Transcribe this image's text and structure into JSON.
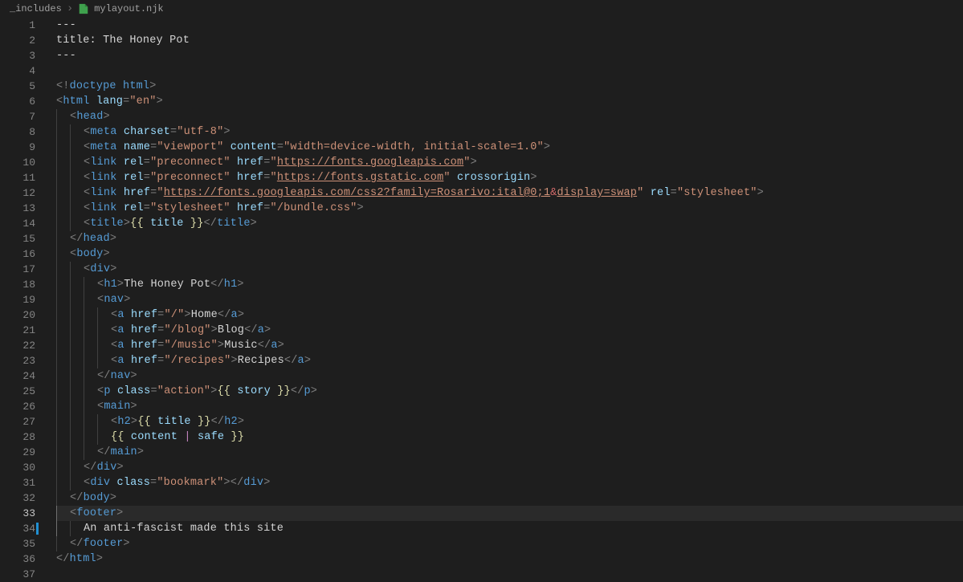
{
  "breadcrumb": {
    "folder": "_includes",
    "file": "mylayout.njk"
  },
  "gutter": {
    "currentLine": 33,
    "modifiedLine": 34,
    "lineCount": 37
  },
  "code": {
    "l1": "---",
    "l2_key": "title: ",
    "l2_val": "The Honey Pot",
    "l3": "---",
    "l5_doctype": "doctype html",
    "l6_tag": "html",
    "l6_attr": "lang",
    "l6_val": "\"en\"",
    "l7_tag": "head",
    "l8_tag": "meta",
    "l8_attr": "charset",
    "l8_val": "\"utf-8\"",
    "l9_tag": "meta",
    "l9_a1": "name",
    "l9_v1": "\"viewport\"",
    "l9_a2": "content",
    "l9_v2": "\"width=device-width, initial-scale=1.0\"",
    "l10_tag": "link",
    "l10_a1": "rel",
    "l10_v1": "\"preconnect\"",
    "l10_a2": "href",
    "l10_q": "\"",
    "l10_url": "https://fonts.googleapis.com",
    "l11_tag": "link",
    "l11_a1": "rel",
    "l11_v1": "\"preconnect\"",
    "l11_a2": "href",
    "l11_q": "\"",
    "l11_url": "https://fonts.gstatic.com",
    "l11_a3": "crossorigin",
    "l12_tag": "link",
    "l12_a1": "href",
    "l12_q": "\"",
    "l12_url1": "https://fonts.googleapis.com/css2?family=Rosarivo:ital@0;1",
    "l12_amp": "&",
    "l12_url2": "display=swap",
    "l12_a2": "rel",
    "l12_v2": "\"stylesheet\"",
    "l13_tag": "link",
    "l13_a1": "rel",
    "l13_v1": "\"stylesheet\"",
    "l13_a2": "href",
    "l13_v2": "\"/bundle.css\"",
    "l14_tag": "title",
    "l14_open": "{{",
    "l14_var": "title",
    "l14_close": "}}",
    "l15_tag": "head",
    "l16_tag": "body",
    "l17_tag": "div",
    "l18_tag": "h1",
    "l18_text": "The Honey Pot",
    "l19_tag": "nav",
    "l20_tag": "a",
    "l20_attr": "href",
    "l20_val": "\"/\"",
    "l20_text": "Home",
    "l21_tag": "a",
    "l21_attr": "href",
    "l21_val": "\"/blog\"",
    "l21_text": "Blog",
    "l22_tag": "a",
    "l22_attr": "href",
    "l22_val": "\"/music\"",
    "l22_text": "Music",
    "l23_tag": "a",
    "l23_attr": "href",
    "l23_val": "\"/recipes\"",
    "l23_text": "Recipes",
    "l24_tag": "nav",
    "l25_tag": "p",
    "l25_attr": "class",
    "l25_val": "\"action\"",
    "l25_open": "{{",
    "l25_var": "story",
    "l25_close": "}}",
    "l26_tag": "main",
    "l27_tag": "h2",
    "l27_open": "{{",
    "l27_var": "title",
    "l27_close": "}}",
    "l28_open": "{{",
    "l28_var": "content",
    "l28_pipe": "|",
    "l28_filter": "safe",
    "l28_close": "}}",
    "l29_tag": "main",
    "l30_tag": "div",
    "l31_tag": "div",
    "l31_attr": "class",
    "l31_val": "\"bookmark\"",
    "l32_tag": "body",
    "l33_tag": "footer",
    "l34_text": "An anti-fascist made this site",
    "l35_tag": "footer",
    "l36_tag": "html"
  }
}
